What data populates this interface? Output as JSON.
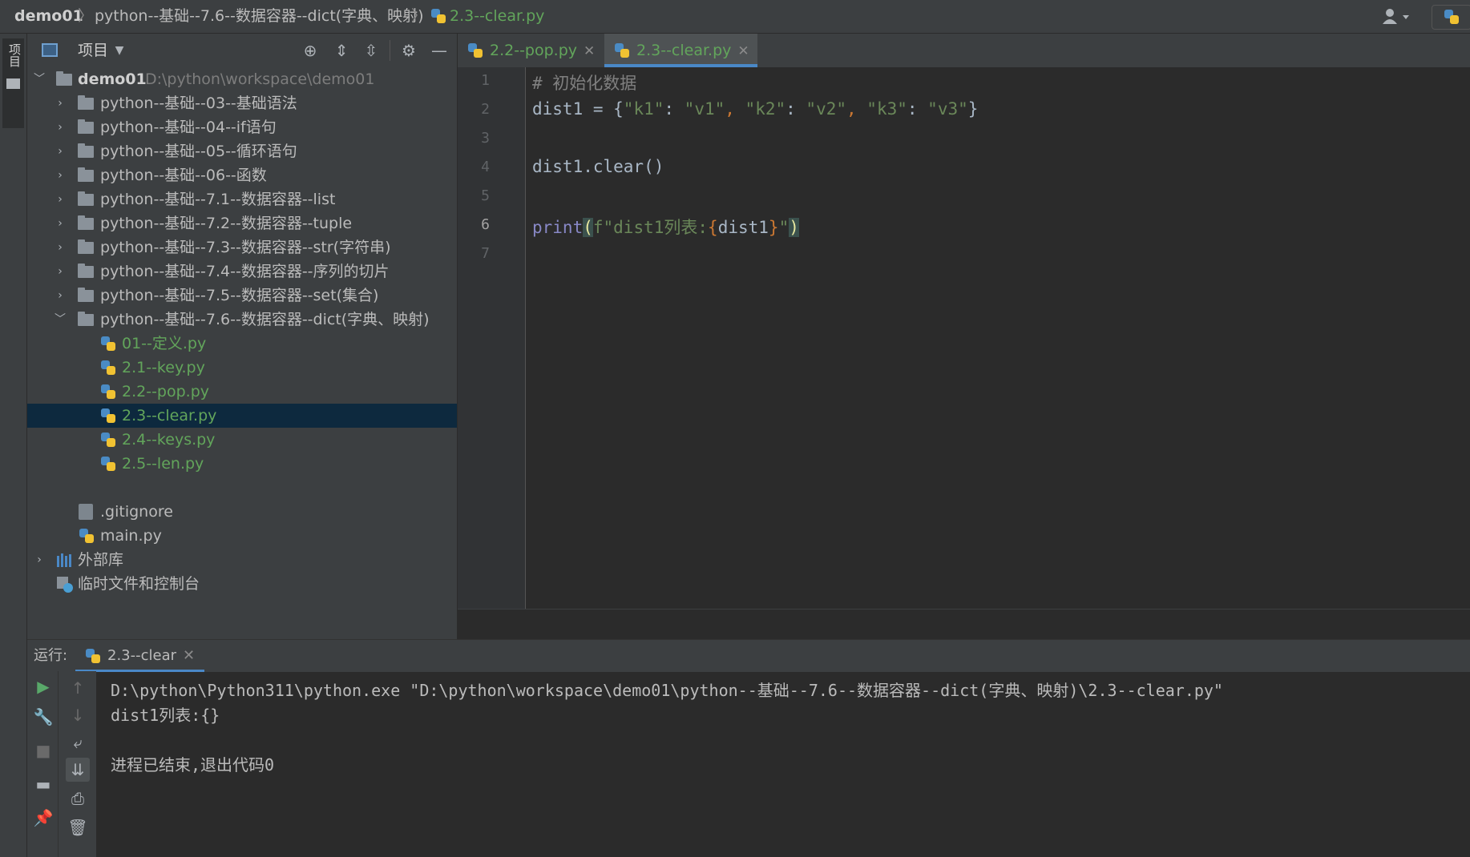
{
  "breadcrumb": {
    "project": "demo01",
    "folder": "python--基础--7.6--数据容器--dict(字典、映射)",
    "file": "2.3--clear.py"
  },
  "project_panel": {
    "title": "项目",
    "strip_label": "项目",
    "root_name": "demo01",
    "root_path": "D:\\python\\workspace\\demo01",
    "folders": [
      "python--基础--03--基础语法",
      "python--基础--04--if语句",
      "python--基础--05--循环语句",
      "python--基础--06--函数",
      "python--基础--7.1--数据容器--list",
      "python--基础--7.2--数据容器--tuple",
      "python--基础--7.3--数据容器--str(字符串)",
      "python--基础--7.4--数据容器--序列的切片",
      "python--基础--7.5--数据容器--set(集合)",
      "python--基础--7.6--数据容器--dict(字典、映射)"
    ],
    "files": [
      "01--定义.py",
      "2.1--key.py",
      "2.2--pop.py",
      "2.3--clear.py",
      "2.4--keys.py",
      "2.5--len.py"
    ],
    "selected_file": "2.3--clear.py",
    "root_files": [
      ".gitignore",
      "main.py"
    ],
    "external_libs": "外部库",
    "scratches": "临时文件和控制台"
  },
  "editor": {
    "tabs": [
      {
        "label": "2.2--pop.py",
        "active": false
      },
      {
        "label": "2.3--clear.py",
        "active": true
      }
    ],
    "line_numbers": [
      "1",
      "2",
      "3",
      "4",
      "5",
      "6",
      "7"
    ],
    "current_line": "6",
    "code": {
      "line1": "# 初始化数据",
      "line2_var": "dist1 = {",
      "k1": "\"k1\"",
      "v1": "\"v1\"",
      "k2": "\"k2\"",
      "v2": "\"v2\"",
      "k3": "\"k3\"",
      "v3": "\"v3\"",
      "colon": ": ",
      "comma": ", ",
      "close_brace": "}",
      "line4": "dist1.clear()",
      "print": "print",
      "paren_open": "(",
      "fprefix": "f\"dist1列表:",
      "interp_open": "{",
      "interp_var": "dist1",
      "interp_close": "}",
      "fsuffix": "\"",
      "paren_close": ")"
    }
  },
  "run": {
    "label": "运行:",
    "tab": "2.3--clear",
    "output": [
      "D:\\python\\Python311\\python.exe \"D:\\python\\workspace\\demo01\\python--基础--7.6--数据容器--dict(字典、映射)\\2.3--clear.py\"",
      "dist1列表:{}",
      "",
      "进程已结束,退出代码0"
    ]
  },
  "colors": {
    "accent": "#4a88c7",
    "python_file": "#62a55b",
    "selection": "#0d293e"
  }
}
